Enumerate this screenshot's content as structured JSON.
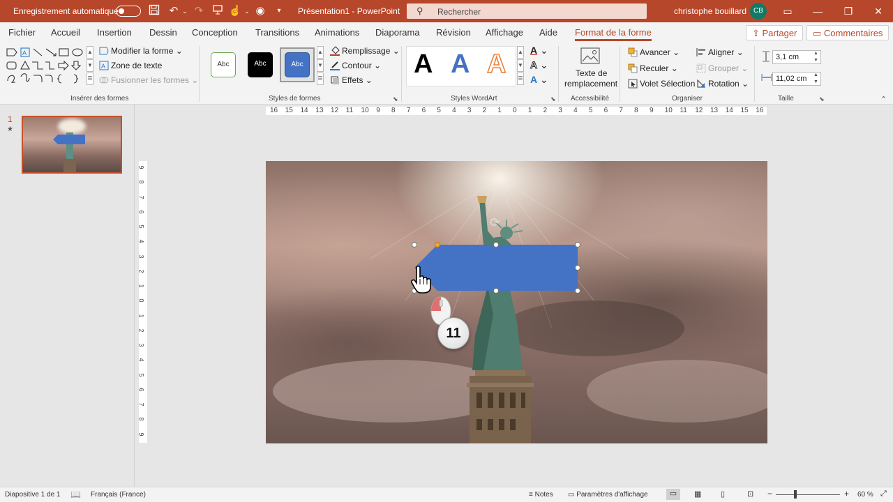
{
  "titlebar": {
    "autosave_label": "Enregistrement automatique",
    "doc_title": "Présentation1  -  PowerPoint",
    "search_placeholder": "Rechercher",
    "user_name": "christophe bouillard",
    "user_initials": "CB"
  },
  "tabs": [
    "Fichier",
    "Accueil",
    "Insertion",
    "Dessin",
    "Conception",
    "Transitions",
    "Animations",
    "Diaporama",
    "Révision",
    "Affichage",
    "Aide",
    "Format de la forme"
  ],
  "active_tab": "Format de la forme",
  "share_label": "Partager",
  "comments_label": "Commentaires",
  "ribbon": {
    "insert_shapes": {
      "modify_shape": "Modifier la forme",
      "text_box": "Zone de texte",
      "merge_shapes": "Fusionner les formes",
      "group_label": "Insérer des formes"
    },
    "shape_styles": {
      "presets": [
        "Abc",
        "Abc",
        "Abc"
      ],
      "fill": "Remplissage",
      "outline": "Contour",
      "effects": "Effets",
      "group_label": "Styles de formes"
    },
    "wordart": {
      "letter": "A",
      "group_label": "Styles WordArt"
    },
    "accessibility": {
      "alt_text_line1": "Texte de",
      "alt_text_line2": "remplacement",
      "group_label": "Accessibilité"
    },
    "arrange": {
      "bring_forward": "Avancer",
      "send_backward": "Reculer",
      "selection_pane": "Volet Sélection",
      "align": "Aligner",
      "group": "Grouper",
      "rotate": "Rotation",
      "group_label": "Organiser"
    },
    "size": {
      "height": "3,1 cm",
      "width": "11,02 cm",
      "group_label": "Taille"
    }
  },
  "ruler_h_labels": [
    "16",
    "15",
    "14",
    "13",
    "12",
    "11",
    "10",
    "9",
    "8",
    "7",
    "6",
    "5",
    "4",
    "3",
    "2",
    "1",
    "0",
    "1",
    "2",
    "3",
    "4",
    "5",
    "6",
    "7",
    "8",
    "9",
    "10",
    "11",
    "12",
    "13",
    "14",
    "15",
    "16"
  ],
  "ruler_v_labels": [
    "9",
    "8",
    "7",
    "6",
    "5",
    "4",
    "3",
    "2",
    "1",
    "0",
    "1",
    "2",
    "3",
    "4",
    "5",
    "6",
    "7",
    "8",
    "9"
  ],
  "thumbnail": {
    "number": "1",
    "star": "★"
  },
  "step_badge": "11",
  "colors": {
    "accent": "#b7472a",
    "shape_fill": "#4472c4"
  },
  "statusbar": {
    "slide_info": "Diapositive 1 de 1",
    "language": "Français (France)",
    "notes": "Notes",
    "display_settings": "Paramètres d'affichage",
    "zoom": "60 %"
  }
}
